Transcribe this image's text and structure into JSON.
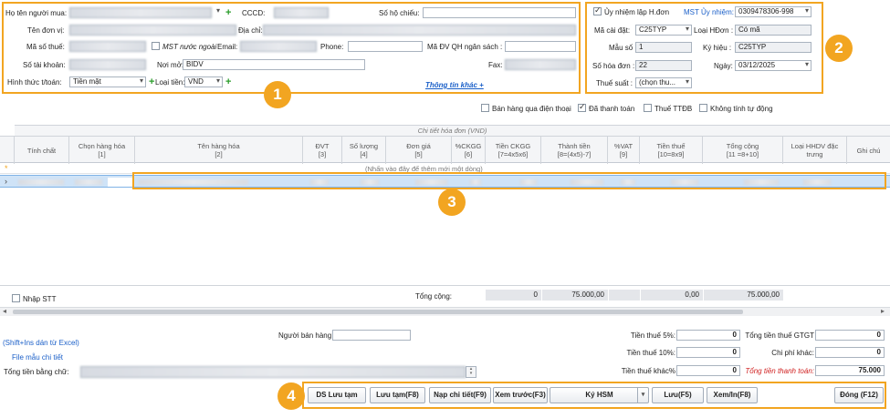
{
  "header": {
    "buyer_name_label": "Họ tên người mua:",
    "cccd_label": "CCCD:",
    "passport_label": "Số hộ chiếu:",
    "unit_name_label": "Tên đơn vị:",
    "address_label": "Địa chỉ:",
    "tax_code_label": "Mã số thuế:",
    "foreign_tax_label": "MST nước ngoài",
    "email_label": "Email:",
    "phone_label": "Phone:",
    "budget_unit_label": "Mã ĐV QH ngân sách :",
    "account_label": "Số tài khoản:",
    "bank_label": "Nơi mở:",
    "bank_value": "BIDV",
    "fax_label": "Fax:",
    "payment_label": "Hình thức t/toán:",
    "payment_value": "Tiền mặt",
    "currency_label": "Loại tiền:",
    "currency_value": "VND",
    "more_info_link": "Thông tin khác +"
  },
  "invoice": {
    "authorize_label": "Ủy nhiệm lập H.đơn",
    "authorize_tax_label": "MST Ủy nhiệm:",
    "authorize_tax_value": "0309478306-998",
    "install_code_label": "Mã cài đặt:",
    "install_code_value": "C25TYP",
    "invoice_type_label": "Loại HĐơn :",
    "invoice_type_value": "Có mã",
    "template_label": "Mẫu số :",
    "template_value": "1",
    "symbol_label": "Ký hiệu :",
    "symbol_value": "C25TYP",
    "number_label": "Số hóa đơn :",
    "number_value": "22",
    "date_label": "Ngày:",
    "date_value": "03/12/2025",
    "tax_rate_label": "Thuế suất :",
    "tax_rate_value": "(chọn thu..."
  },
  "options": {
    "phone_sale": "Bán hàng qua điện thoại",
    "paid": "Đã thanh toán",
    "special_tax": "Thuế TTĐB",
    "no_auto_calc": "Không tính tự động"
  },
  "grid": {
    "caption": "Chi tiết hóa đơn (VND)",
    "columns": [
      "Tính chất",
      "Chọn hàng hóa\n[1]",
      "Tên hàng hóa\n[2]",
      "ĐVT\n[3]",
      "Số lượng\n[4]",
      "Đơn giá\n[5]",
      "%CKGG\n[6]",
      "Tiền CKGG\n[7=4x5x6]",
      "Thành tiền\n[8=(4x5)-7]",
      "%VAT\n[9]",
      "Tiền thuế\n[10=8x9]",
      "Tổng cộng\n[11 =8+10]",
      "Loại HHDV đặc\ntrưng",
      "Ghi chú"
    ],
    "new_row_hint": "(Nhấn vào đây để thêm mới một dòng)",
    "new_row_marker": "*",
    "row_marker": "›",
    "seq_label": "Nhập STT",
    "total_label": "Tổng cộng:",
    "total_discount": "0",
    "total_amount": "75.000,00",
    "total_tax": "0,00",
    "total_sum": "75.000,00"
  },
  "footer": {
    "paste_hint": "(Shift+Ins dán từ Excel)",
    "template_link": "File mẫu chi tiết",
    "words_label": "Tổng tiền bằng chữ:",
    "seller_label": "Người bán hàng:",
    "tax5_label": "Tiền thuế 5%:",
    "tax5_value": "0",
    "tax10_label": "Tiền thuế 10%:",
    "tax10_value": "0",
    "tax_other_label": "Tiền thuế khác%",
    "tax_other_value": "0",
    "total_vat_label": "Tổng tiền thuế GTGT",
    "total_vat_value": "0",
    "other_cost_label": "Chi phí khác:",
    "other_cost_value": "0",
    "grand_total_label": "Tổng tiền thanh toán:",
    "grand_total_value": "75.000"
  },
  "buttons": {
    "draft_list": "DS Lưu tạm",
    "save_draft": "Lưu tạm(F8)",
    "load_detail": "Nạp chi tiết(F9)",
    "preview": "Xem trước(F3)",
    "sign_hsm": "Ký HSM",
    "save": "Lưu(F5)",
    "view_print": "Xem/In(F8)",
    "close": "Đóng (F12)"
  },
  "badges": [
    "1",
    "2",
    "3",
    "4"
  ],
  "colors": {
    "highlight": "#f2a521",
    "link": "#1a5fc8",
    "selected_row": "#cfe3f7",
    "red_label": "#d02020"
  }
}
